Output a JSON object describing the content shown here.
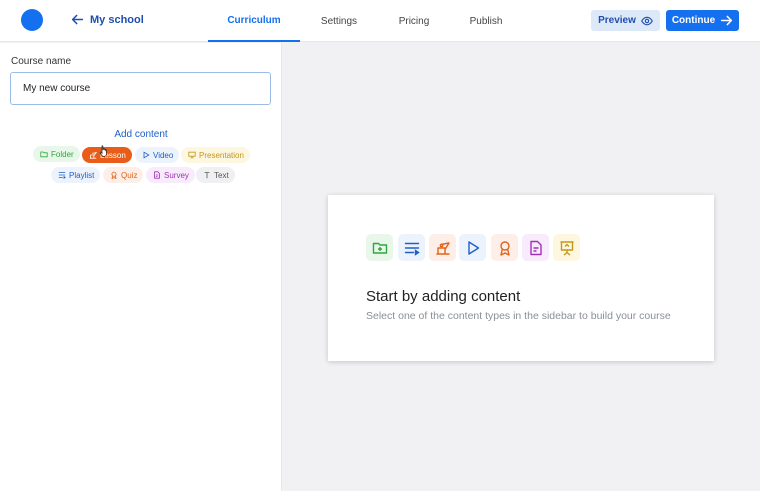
{
  "header": {
    "back_label": "My school",
    "tabs": [
      {
        "label": "Curriculum",
        "active": true
      },
      {
        "label": "Settings"
      },
      {
        "label": "Pricing"
      },
      {
        "label": "Publish"
      }
    ],
    "preview_label": "Preview",
    "continue_label": "Continue"
  },
  "sidebar": {
    "course_name_label": "Course name",
    "course_name_value": "My new course",
    "add_content_label": "Add content",
    "content_types": [
      {
        "label": "Folder",
        "icon": "folder-icon"
      },
      {
        "label": "Lesson",
        "icon": "lesson-icon",
        "active": true
      },
      {
        "label": "Video",
        "icon": "play-icon"
      },
      {
        "label": "Presentation",
        "icon": "presentation-icon"
      },
      {
        "label": "Playlist",
        "icon": "playlist-icon"
      },
      {
        "label": "Quiz",
        "icon": "award-icon"
      },
      {
        "label": "Survey",
        "icon": "survey-icon"
      },
      {
        "label": "Text",
        "icon": "text-icon"
      }
    ]
  },
  "empty_state": {
    "title": "Start by adding content",
    "subtitle": "Select one of the content types in the sidebar to build your course"
  },
  "colors": {
    "accent": "#1570ef",
    "folder": "#2ea73b",
    "lesson": "#ea5d18",
    "video": "#1e5fc8",
    "presentation": "#c7951a",
    "quiz": "#e0631c",
    "survey": "#a330b8"
  }
}
